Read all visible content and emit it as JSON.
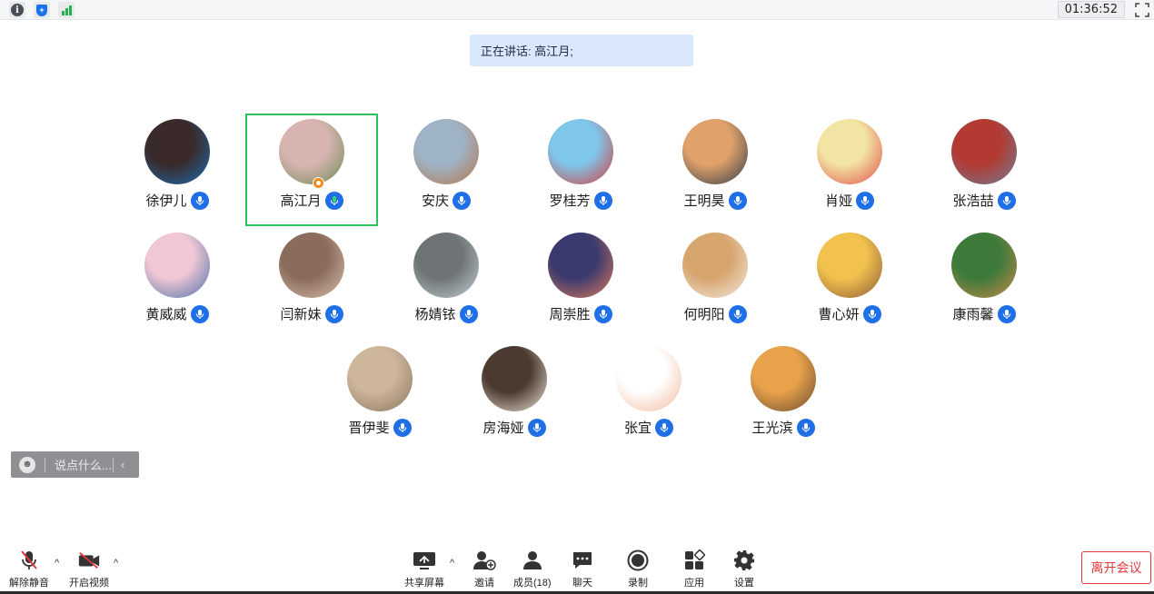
{
  "topbar": {
    "timer": "01:36:52",
    "icons": [
      "info-icon",
      "security-shield-icon",
      "network-signal-icon",
      "fullscreen-icon"
    ],
    "shield_glyph": "+",
    "info_glyph": "i"
  },
  "speaking": {
    "label": "正在讲话: ",
    "speaker": "高江月;"
  },
  "participants": [
    {
      "name": "徐伊儿",
      "avatar_colors": [
        "#3a2a2a",
        "#1b6fb3"
      ],
      "active": false,
      "host": false
    },
    {
      "name": "高江月",
      "avatar_colors": [
        "#d8b4b0",
        "#6d8b55"
      ],
      "active": true,
      "host": true
    },
    {
      "name": "安庆",
      "avatar_colors": [
        "#9fb3c6",
        "#b3774a"
      ],
      "active": false,
      "host": false
    },
    {
      "name": "罗桂芳",
      "avatar_colors": [
        "#7ec6ea",
        "#d73b3b"
      ],
      "active": false,
      "host": false
    },
    {
      "name": "王明昊",
      "avatar_colors": [
        "#e0a16a",
        "#2d3a4a"
      ],
      "active": false,
      "host": false
    },
    {
      "name": "肖娅",
      "avatar_colors": [
        "#f2e4a2",
        "#e04c4c"
      ],
      "active": false,
      "host": false
    },
    {
      "name": "张浩喆",
      "avatar_colors": [
        "#b23a32",
        "#6e7f98"
      ],
      "active": false,
      "host": false
    },
    {
      "name": "黄威威",
      "avatar_colors": [
        "#f0c7d4",
        "#4b6fa8"
      ],
      "active": false,
      "host": false
    },
    {
      "name": "闫新妹",
      "avatar_colors": [
        "#8a6b5c",
        "#d8c2b0"
      ],
      "active": false,
      "host": false
    },
    {
      "name": "杨婧铱",
      "avatar_colors": [
        "#6e7476",
        "#c7cfd4"
      ],
      "active": false,
      "host": false
    },
    {
      "name": "周崇胜",
      "avatar_colors": [
        "#3b3a6e",
        "#e07b5a"
      ],
      "active": false,
      "host": false
    },
    {
      "name": "何明阳",
      "avatar_colors": [
        "#d7a56e",
        "#f2ece4"
      ],
      "active": false,
      "host": false
    },
    {
      "name": "曹心妍",
      "avatar_colors": [
        "#f2c24e",
        "#8a5a3a"
      ],
      "active": false,
      "host": false
    },
    {
      "name": "康雨馨",
      "avatar_colors": [
        "#3d7a3a",
        "#c98a4a"
      ],
      "active": false,
      "host": false
    },
    {
      "name": "晋伊斐",
      "avatar_colors": [
        "#cdb69a",
        "#8a7560"
      ],
      "active": false,
      "host": false
    },
    {
      "name": "房海娅",
      "avatar_colors": [
        "#4a3a30",
        "#f0e6d8"
      ],
      "active": false,
      "host": false
    },
    {
      "name": "张宜",
      "avatar_colors": [
        "#ffffff",
        "#f2b79b"
      ],
      "active": false,
      "host": false
    },
    {
      "name": "王光滨",
      "avatar_colors": [
        "#e8a24a",
        "#6b4a30"
      ],
      "active": false,
      "host": false
    }
  ],
  "chat": {
    "placeholder": "说点什么...",
    "emoji_glyph": "☻",
    "collapse_glyph": "‹"
  },
  "toolbar": {
    "unmute": "解除静音",
    "start_video": "开启视频",
    "share_screen": "共享屏幕",
    "invite": "邀请",
    "members": "成员(18)",
    "chat": "聊天",
    "record": "录制",
    "apps": "应用",
    "settings": "设置",
    "leave": "离开会议",
    "caret_glyph": "^"
  },
  "colors": {
    "accent_blue": "#1f6fe6",
    "active_border": "#2ec25f",
    "leave_red": "#e4383c",
    "signal_green": "#22b14c",
    "banner_bg": "#d9e8fb"
  }
}
